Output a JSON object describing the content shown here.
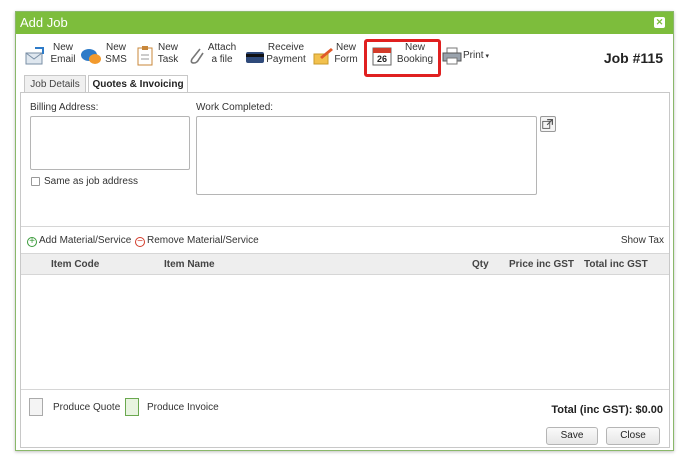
{
  "dialog": {
    "title": "Add Job",
    "job_number": "Job #115"
  },
  "toolbar": {
    "items": [
      {
        "label": "New\nEmail",
        "icon": "email-icon"
      },
      {
        "label": "New\nSMS",
        "icon": "sms-icon"
      },
      {
        "label": "New\nTask",
        "icon": "task-icon"
      },
      {
        "label": "Attach\na file",
        "icon": "paperclip-icon"
      },
      {
        "label": "Receive\nPayment",
        "icon": "payment-card-icon"
      },
      {
        "label": "New\nForm",
        "icon": "form-icon"
      },
      {
        "label": "New\nBooking",
        "icon": "calendar-icon",
        "calendar_day": "26"
      },
      {
        "label": "Print",
        "icon": "printer-icon"
      }
    ]
  },
  "tabs": [
    {
      "label": "Job Details",
      "active": false
    },
    {
      "label": "Quotes & Invoicing",
      "active": true
    }
  ],
  "form": {
    "billing_address_label": "Billing Address:",
    "work_completed_label": "Work Completed:",
    "same_as_job_address": "Same as job address"
  },
  "materials": {
    "add_label": "Add Material/Service",
    "remove_label": "Remove Material/Service",
    "show_tax": "Show Tax",
    "columns": [
      "Item Code",
      "Item Name",
      "Qty",
      "Price inc GST",
      "Total inc GST"
    ]
  },
  "footer": {
    "produce_quote": "Produce Quote",
    "produce_invoice": "Produce Invoice",
    "total": "Total (inc GST): $0.00"
  },
  "buttons": {
    "save": "Save",
    "close": "Close"
  },
  "colors": {
    "titlebar": "#7dbd3c",
    "highlight": "#e02020"
  }
}
